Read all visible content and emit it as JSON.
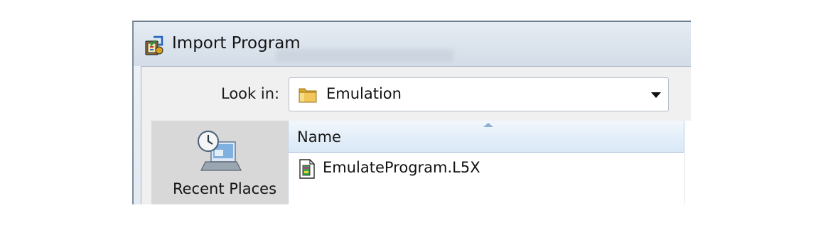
{
  "dialog": {
    "title": "Import Program",
    "app_icon": "import-program-icon"
  },
  "look_in": {
    "label": "Look in:",
    "value": "Emulation",
    "icon": "folder-icon"
  },
  "places_bar": {
    "items": [
      {
        "label": "Recent Places",
        "icon": "recent-places-icon"
      }
    ]
  },
  "file_list": {
    "columns": [
      {
        "label": "Name",
        "sorted": "ascending"
      }
    ],
    "files": [
      {
        "name": "EmulateProgram.L5X",
        "icon": "l5x-file-icon"
      }
    ]
  },
  "colors": {
    "header_gradient_top": "#f2f7fc",
    "header_gradient_bottom": "#d9e8f6",
    "folder_yellow": "#e8b73a"
  }
}
